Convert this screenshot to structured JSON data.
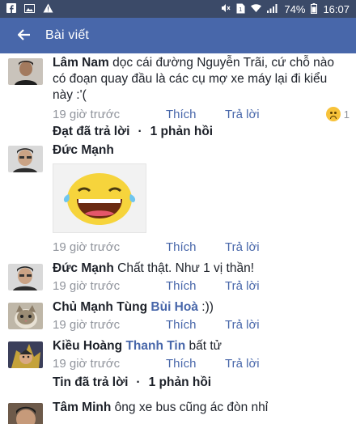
{
  "status_bar": {
    "left_icons": [
      "facebook-icon",
      "image-icon",
      "warning-icon"
    ],
    "battery": "74%",
    "time": "16:07"
  },
  "app_bar": {
    "title": "Bài viết"
  },
  "comments": [
    {
      "author": "Lâm Nam",
      "text": "dọc cái đường Nguyễn Trãi, cứ chỗ nào có đoạn quay đầu là các cụ mợ xe máy lại đi kiểu này :'(",
      "time": "19 giờ trước",
      "like": "Thích",
      "reply": "Trả lời",
      "reaction_count": "1",
      "replies_text": "Đạt đã trả lời",
      "replies_count": "1 phản hồi"
    },
    {
      "author": "Đức Mạnh",
      "text": "",
      "time": "19 giờ trước",
      "like": "Thích",
      "reply": "Trả lời"
    },
    {
      "author": "Đức Mạnh",
      "text": "Chất thật. Như 1 vị thần!",
      "time": "19 giờ trước",
      "like": "Thích",
      "reply": "Trả lời"
    },
    {
      "author": "Chủ Mạnh Tùng",
      "mention": "Bùi Hoà",
      "text": ":))",
      "time": "19 giờ trước",
      "like": "Thích",
      "reply": "Trả lời"
    },
    {
      "author": "Kiều Hoàng",
      "mention": "Thanh Tin",
      "text": "bất tử",
      "time": "19 giờ trước",
      "like": "Thích",
      "reply": "Trả lời",
      "replies_text": "Tin đã trả lời",
      "replies_count": "1 phản hồi"
    },
    {
      "author": "Tâm Minh",
      "text": "ông xe bus cũng ác đòn nhỉ"
    }
  ],
  "colors": {
    "status_bar": "#3b4a68",
    "app_bar": "#4867aa",
    "link": "#4867aa",
    "meta": "#90949c"
  }
}
